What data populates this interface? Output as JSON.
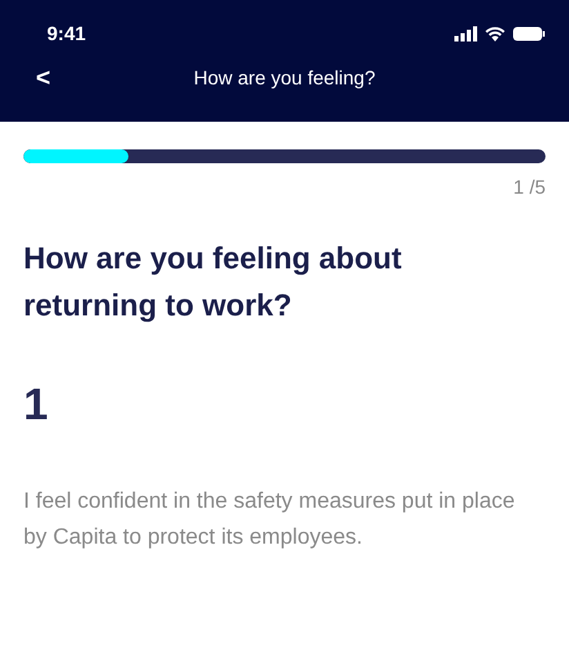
{
  "status_bar": {
    "time": "9:41"
  },
  "nav": {
    "back": "<",
    "title": "How are you feeling?"
  },
  "progress": {
    "level": 0.2,
    "counter": "1 /5"
  },
  "question": "How are you feeling about returning to work?",
  "answer_value": "1",
  "statement": "I feel confident in the safety measures put in place by Capita to protect its employees."
}
